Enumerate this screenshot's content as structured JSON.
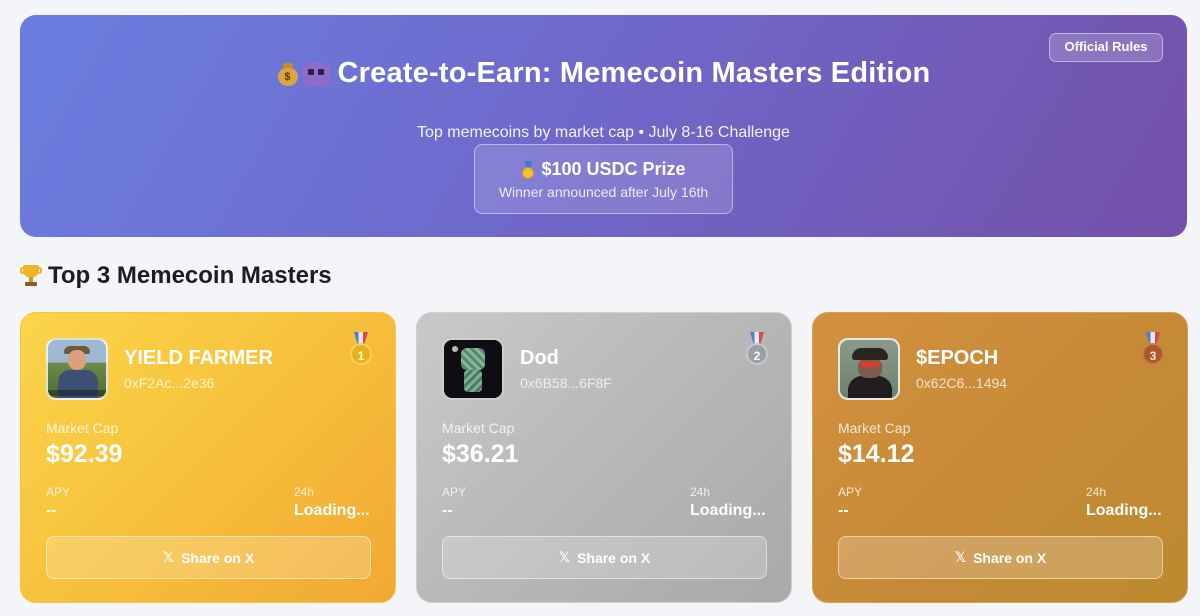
{
  "hero": {
    "rules_label": "Official Rules",
    "title": "Create-to-Earn: Memecoin Masters Edition",
    "subtitle": "Top memecoins by market cap • July 8-16 Challenge",
    "prize_title": "$100 USDC Prize",
    "prize_sub": "Winner announced after July 16th",
    "title_icons": [
      "money-bag-icon",
      "alien-invader-icon"
    ],
    "prize_icon": "medal-icon"
  },
  "section": {
    "title": "Top 3 Memecoin Masters",
    "icon": "trophy-icon"
  },
  "cards": [
    {
      "rank": "1",
      "name": "YIELD FARMER",
      "address": "0xF2Ac...2e36",
      "mc_label": "Market Cap",
      "mc_value": "$92.39",
      "apy_label": "APY",
      "apy_value": "--",
      "change_label": "24h",
      "change_value": "Loading...",
      "share_label": "Share on X",
      "x_glyph": "𝕏",
      "color": "#f6be3a"
    },
    {
      "rank": "2",
      "name": "Dod",
      "address": "0x6B58...6F8F",
      "mc_label": "Market Cap",
      "mc_value": "$36.21",
      "apy_label": "APY",
      "apy_value": "--",
      "change_label": "24h",
      "change_value": "Loading...",
      "share_label": "Share on X",
      "x_glyph": "𝕏",
      "color": "#b6b6b6"
    },
    {
      "rank": "3",
      "name": "$EPOCH",
      "address": "0x62C6...1494",
      "mc_label": "Market Cap",
      "mc_value": "$14.12",
      "apy_label": "APY",
      "apy_value": "--",
      "change_label": "24h",
      "change_value": "Loading...",
      "share_label": "Share on X",
      "x_glyph": "𝕏",
      "color": "#c68a37"
    }
  ]
}
